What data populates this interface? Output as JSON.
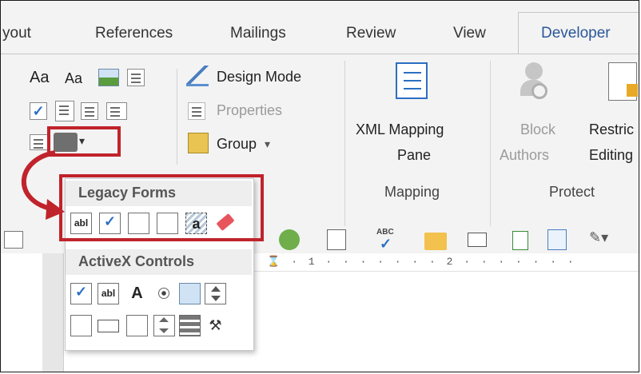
{
  "tabs": [
    "yout",
    "References",
    "Mailings",
    "Review",
    "View"
  ],
  "active_tab": "Developer",
  "controls_group": {
    "design_mode": "Design Mode",
    "properties": "Properties",
    "group": "Group",
    "dropdown_arrow": "▾"
  },
  "mapping_group": {
    "button_line1": "XML Mapping",
    "button_line2": "Pane",
    "label": "Mapping"
  },
  "protect_group": {
    "block_line1": "Block",
    "block_line2": "Authors",
    "restrict_line1": "Restric",
    "restrict_line2": "Editing",
    "label": "Protect"
  },
  "icons": {
    "aa_large": "Aa",
    "aa_small": "Aa"
  },
  "dropdown": {
    "legacy_header": "Legacy Forms",
    "activex_header": "ActiveX Controls",
    "abl": "abl",
    "label_A": "A",
    "abc": "ABC"
  },
  "ruler": {
    "text": "· · ⌛ · 1 · · · · · · · 2 · · · · · · ·"
  },
  "colors": {
    "highlight": "#c0232b",
    "accent": "#2b579a"
  }
}
